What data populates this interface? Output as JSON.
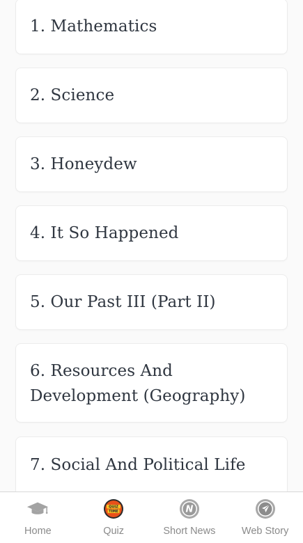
{
  "subjects": [
    {
      "label": "1. Mathematics"
    },
    {
      "label": "2. Science"
    },
    {
      "label": "3. Honeydew"
    },
    {
      "label": "4. It So Happened"
    },
    {
      "label": "5. Our Past III (Part II)"
    },
    {
      "label": "6. Resources And Development (Geography)"
    },
    {
      "label": "7. Social And Political Life"
    }
  ],
  "bottom_nav": {
    "items": [
      {
        "label": "Home",
        "icon": "graduation-cap-icon"
      },
      {
        "label": "Quiz",
        "icon": "quiz-time-icon",
        "icon_text": "QUIZ TIME"
      },
      {
        "label": "Short News",
        "icon": "news-n-icon",
        "icon_text": "N"
      },
      {
        "label": "Web Story",
        "icon": "paper-plane-icon"
      }
    ]
  },
  "colors": {
    "background": "#fafafa",
    "card": "#ffffff",
    "title_text": "#2f3640",
    "nav_label": "#8a8a8a",
    "nav_icon_gray": "#9a9a9a",
    "quiz_icon_bg": "#2b2b2b",
    "quiz_icon_accent": "#f26b1d"
  }
}
